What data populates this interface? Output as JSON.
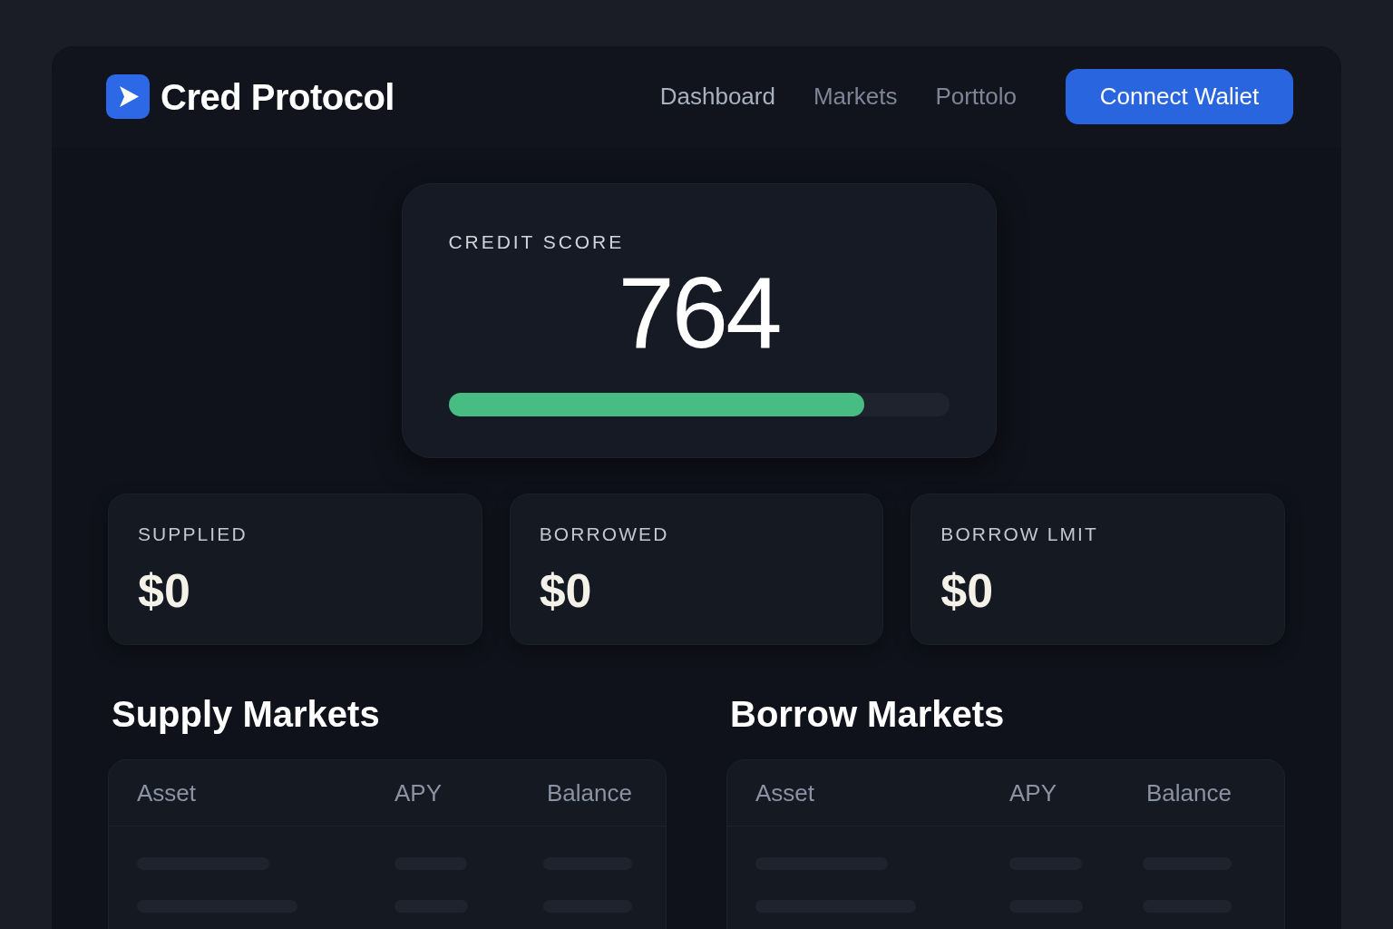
{
  "header": {
    "brand": "Cred Protocol",
    "nav": [
      {
        "label": "Dashboard",
        "selected": true
      },
      {
        "label": "Markets",
        "selected": false
      },
      {
        "label": "Porttolo",
        "selected": false
      }
    ],
    "connect_button": "Connect Waliet"
  },
  "credit_score": {
    "label": "CREDIT SCORE",
    "value": "764",
    "level": 0.83
  },
  "stats": [
    {
      "label": "SUPPLIED",
      "value": "$0"
    },
    {
      "label": "BORROWED",
      "value": "$0"
    },
    {
      "label": "BORROW LMIT",
      "value": "$0"
    }
  ],
  "markets": [
    {
      "title": "Supply Markets",
      "columns": [
        "Asset",
        "APY",
        "Balance"
      ]
    },
    {
      "title": "Borrow Markets",
      "columns": [
        "Asset",
        "APY",
        "Balance"
      ]
    }
  ]
}
